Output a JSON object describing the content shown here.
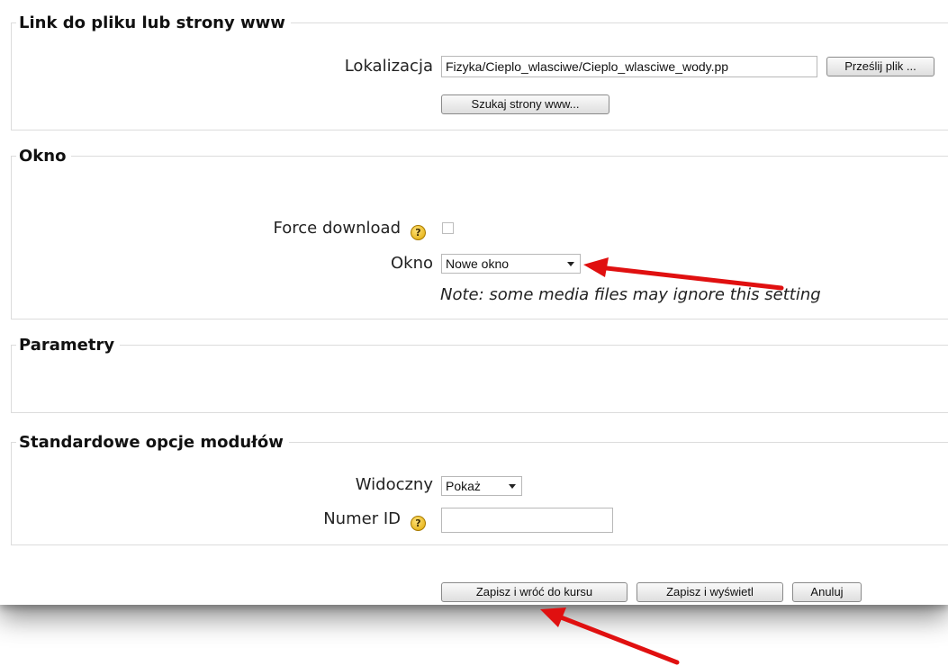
{
  "link_section": {
    "legend": "Link do pliku lub strony www",
    "location_label": "Lokalizacja",
    "location_value": "Fizyka/Cieplo_wlasciwe/Cieplo_wlasciwe_wody.pp",
    "upload_button": "Prześlij plik ...",
    "search_web_button": "Szukaj strony www..."
  },
  "window_section": {
    "legend": "Okno",
    "force_download_label": "Force download",
    "force_download_checked": false,
    "window_label": "Okno",
    "window_selected": "Nowe okno",
    "note": "Note: some media files may ignore this setting"
  },
  "params_section": {
    "legend": "Parametry"
  },
  "module_section": {
    "legend": "Standardowe opcje modułów",
    "visible_label": "Widoczny",
    "visible_selected": "Pokaż",
    "id_label": "Numer ID",
    "id_value": ""
  },
  "actions": {
    "save_return": "Zapisz i wróć do kursu",
    "save_display": "Zapisz i wyświetl",
    "cancel": "Anuluj"
  },
  "icons": {
    "help": "help-icon",
    "dropdown": "chevron-down-icon",
    "annotation": "red-arrow"
  },
  "colors": {
    "annotation_arrow": "#e01010",
    "help_icon": "#f0b400"
  }
}
